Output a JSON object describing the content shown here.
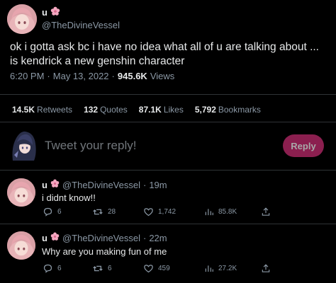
{
  "main_tweet": {
    "name": "u",
    "handle": "@TheDivineVessel",
    "text": "ok i gotta ask bc i have no idea what all of u are talking about ... is kendrick a new genshin character",
    "time": "6:20 PM",
    "sep1": "·",
    "date": "May 13, 2022",
    "sep2": "·",
    "views_num": "945.6K",
    "views_label": "Views",
    "stats": {
      "retweets_num": "14.5K",
      "retweets_label": "Retweets",
      "quotes_num": "132",
      "quotes_label": "Quotes",
      "likes_num": "87.1K",
      "likes_label": "Likes",
      "bookmarks_num": "5,792",
      "bookmarks_label": "Bookmarks"
    }
  },
  "reply_box": {
    "placeholder": "Tweet your reply!",
    "button": "Reply"
  },
  "replies": [
    {
      "name": "u",
      "handle": "@TheDivineVessel",
      "dot": "·",
      "time": "19m",
      "text": "i didnt know!!",
      "replies": "6",
      "retweets": "28",
      "likes": "1,742",
      "views": "85.8K"
    },
    {
      "name": "u",
      "handle": "@TheDivineVessel",
      "dot": "·",
      "time": "22m",
      "text": "Why are you making fun of me",
      "replies": "6",
      "retweets": "6",
      "likes": "459",
      "views": "27.2K"
    }
  ],
  "colors": {
    "background": "#000000",
    "text": "#e7e9ea",
    "muted": "#8b98a5",
    "divider": "#2f3336",
    "reply_button": "#8b1f4f",
    "flower": "#f4a7c0"
  },
  "icons": [
    "sakura-flower-icon",
    "reply-icon",
    "retweet-icon",
    "like-icon",
    "views-icon",
    "share-icon"
  ]
}
